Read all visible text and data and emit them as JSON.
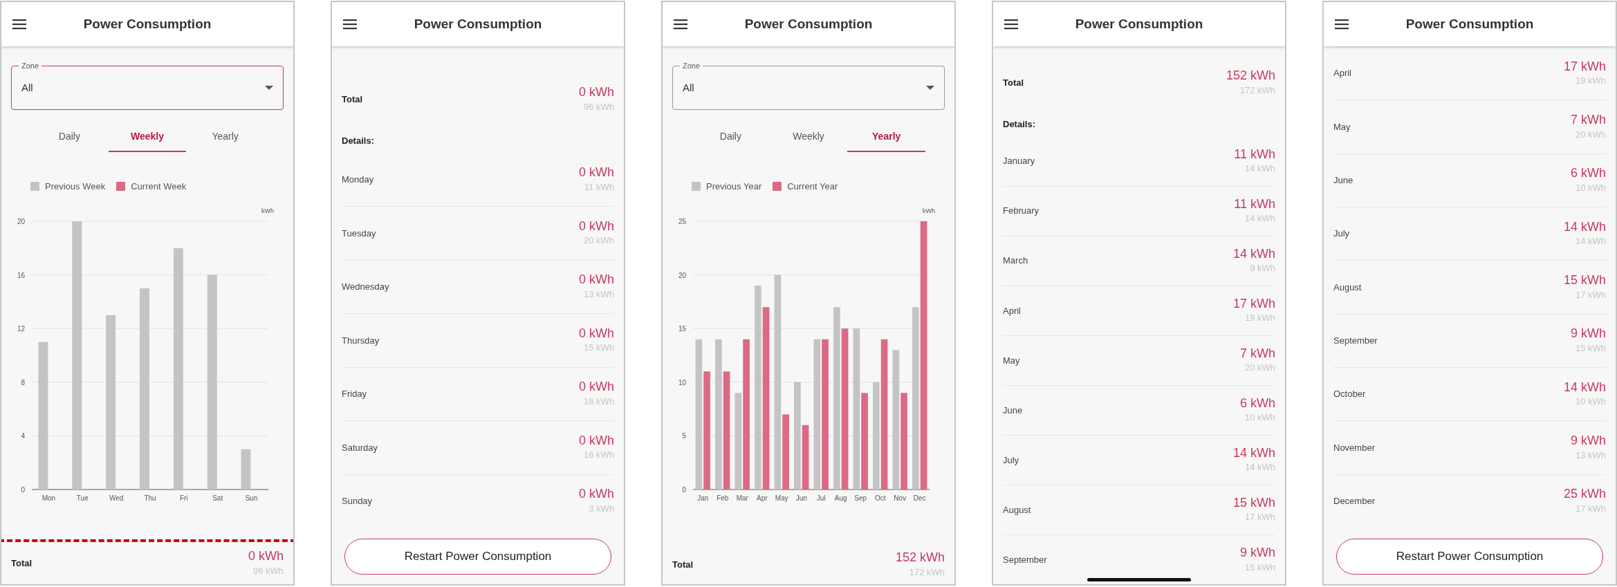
{
  "screens": [
    {
      "header": {
        "title": "Power Consumption"
      },
      "sections": [
        {
          "kind": "zone",
          "label": "Zone",
          "value": "All",
          "focused": true
        },
        {
          "kind": "tabs",
          "tabs": [
            {
              "label": "Daily",
              "selected": false
            },
            {
              "label": "Weekly",
              "selected": true
            },
            {
              "label": "Yearly",
              "selected": false
            }
          ]
        },
        {
          "kind": "chart",
          "chart_data": {
            "type": "bar",
            "ylabel": "kWh",
            "categories": [
              "Mon",
              "Tue",
              "Wed",
              "Thu",
              "Fri",
              "Sat",
              "Sun"
            ],
            "series": [
              {
                "name": "Previous Week",
                "color": "#c4c4c4",
                "values": [
                  11,
                  20,
                  13,
                  15,
                  18,
                  16,
                  3
                ]
              },
              {
                "name": "Current Week",
                "color": "#dc6a84",
                "values": [
                  0,
                  0,
                  0,
                  0,
                  0,
                  0,
                  0
                ]
              }
            ],
            "ylim": [
              0,
              20
            ],
            "yticks": [
              0,
              4,
              8,
              12,
              16,
              20
            ],
            "grid": true
          }
        },
        {
          "kind": "total",
          "label": "Total",
          "current": "0 kWh",
          "previous": "96 kWh",
          "highlighted": true
        }
      ]
    },
    {
      "header": {
        "title": "Power Consumption"
      },
      "sections": [
        {
          "kind": "total",
          "label": "Total",
          "current": "0 kWh",
          "previous": "96 kWh",
          "highlighted": false
        },
        {
          "kind": "heading",
          "text": "Details:"
        },
        {
          "kind": "rows",
          "rows": [
            {
              "label": "Monday",
              "current": "0 kWh",
              "previous": "11 kWh"
            },
            {
              "label": "Tuesday",
              "current": "0 kWh",
              "previous": "20 kWh"
            },
            {
              "label": "Wednesday",
              "current": "0 kWh",
              "previous": "13 kWh"
            },
            {
              "label": "Thursday",
              "current": "0 kWh",
              "previous": "15 kWh"
            },
            {
              "label": "Friday",
              "current": "0 kWh",
              "previous": "18 kWh"
            },
            {
              "label": "Saturday",
              "current": "0 kWh",
              "previous": "16 kWh"
            },
            {
              "label": "Sunday",
              "current": "0 kWh",
              "previous": "3 kWh"
            }
          ]
        },
        {
          "kind": "button",
          "label": "Restart Power Consumption"
        }
      ]
    },
    {
      "header": {
        "title": "Power Consumption"
      },
      "sections": [
        {
          "kind": "zone",
          "label": "Zone",
          "value": "All",
          "focused": false
        },
        {
          "kind": "tabs",
          "tabs": [
            {
              "label": "Daily",
              "selected": false
            },
            {
              "label": "Weekly",
              "selected": false
            },
            {
              "label": "Yearly",
              "selected": true
            }
          ]
        },
        {
          "kind": "chart",
          "chart_data": {
            "type": "bar",
            "ylabel": "kWh",
            "categories": [
              "Jan",
              "Feb",
              "Mar",
              "Apr",
              "May",
              "Jun",
              "Jul",
              "Aug",
              "Sep",
              "Oct",
              "Nov",
              "Dec"
            ],
            "series": [
              {
                "name": "Previous Year",
                "color": "#c4c4c4",
                "values": [
                  14,
                  14,
                  9,
                  19,
                  20,
                  10,
                  14,
                  17,
                  15,
                  10,
                  13,
                  17
                ]
              },
              {
                "name": "Current Year",
                "color": "#dc6a84",
                "values": [
                  11,
                  11,
                  14,
                  17,
                  7,
                  6,
                  14,
                  15,
                  9,
                  14,
                  9,
                  25
                ]
              }
            ],
            "ylim": [
              0,
              25
            ],
            "yticks": [
              0,
              5,
              10,
              15,
              20,
              25
            ],
            "grid": true
          }
        },
        {
          "kind": "total",
          "label": "Total",
          "current": "152 kWh",
          "previous": "172 kWh",
          "highlighted": false
        }
      ]
    },
    {
      "header": {
        "title": "Power Consumption"
      },
      "home_indicator": true,
      "sections": [
        {
          "kind": "total",
          "label": "Total",
          "current": "152 kWh",
          "previous": "172 kWh",
          "highlighted": false
        },
        {
          "kind": "heading",
          "text": "Details:"
        },
        {
          "kind": "rows",
          "rows": [
            {
              "label": "January",
              "current": "11 kWh",
              "previous": "14 kWh"
            },
            {
              "label": "February",
              "current": "11 kWh",
              "previous": "14 kWh"
            },
            {
              "label": "March",
              "current": "14 kWh",
              "previous": "9 kWh"
            },
            {
              "label": "April",
              "current": "17 kWh",
              "previous": "19 kWh"
            },
            {
              "label": "May",
              "current": "7 kWh",
              "previous": "20 kWh"
            },
            {
              "label": "June",
              "current": "6 kWh",
              "previous": "10 kWh"
            },
            {
              "label": "July",
              "current": "14 kWh",
              "previous": "14 kWh"
            },
            {
              "label": "August",
              "current": "15 kWh",
              "previous": "17 kWh"
            },
            {
              "label": "September",
              "current": "9 kWh",
              "previous": "15 kWh"
            }
          ]
        }
      ]
    },
    {
      "header": {
        "title": "Power Consumption"
      },
      "sections": [
        {
          "kind": "rows",
          "rows": [
            {
              "label": "April",
              "current": "17 kWh",
              "previous": "19 kWh"
            },
            {
              "label": "May",
              "current": "7 kWh",
              "previous": "20 kWh"
            },
            {
              "label": "June",
              "current": "6 kWh",
              "previous": "10 kWh"
            },
            {
              "label": "July",
              "current": "14 kWh",
              "previous": "14 kWh"
            },
            {
              "label": "August",
              "current": "15 kWh",
              "previous": "17 kWh"
            },
            {
              "label": "September",
              "current": "9 kWh",
              "previous": "15 kWh"
            },
            {
              "label": "October",
              "current": "14 kWh",
              "previous": "10 kWh"
            },
            {
              "label": "November",
              "current": "9 kWh",
              "previous": "13 kWh"
            },
            {
              "label": "December",
              "current": "25 kWh",
              "previous": "17 kWh"
            }
          ]
        },
        {
          "kind": "button",
          "label": "Restart Power Consumption"
        }
      ]
    }
  ]
}
